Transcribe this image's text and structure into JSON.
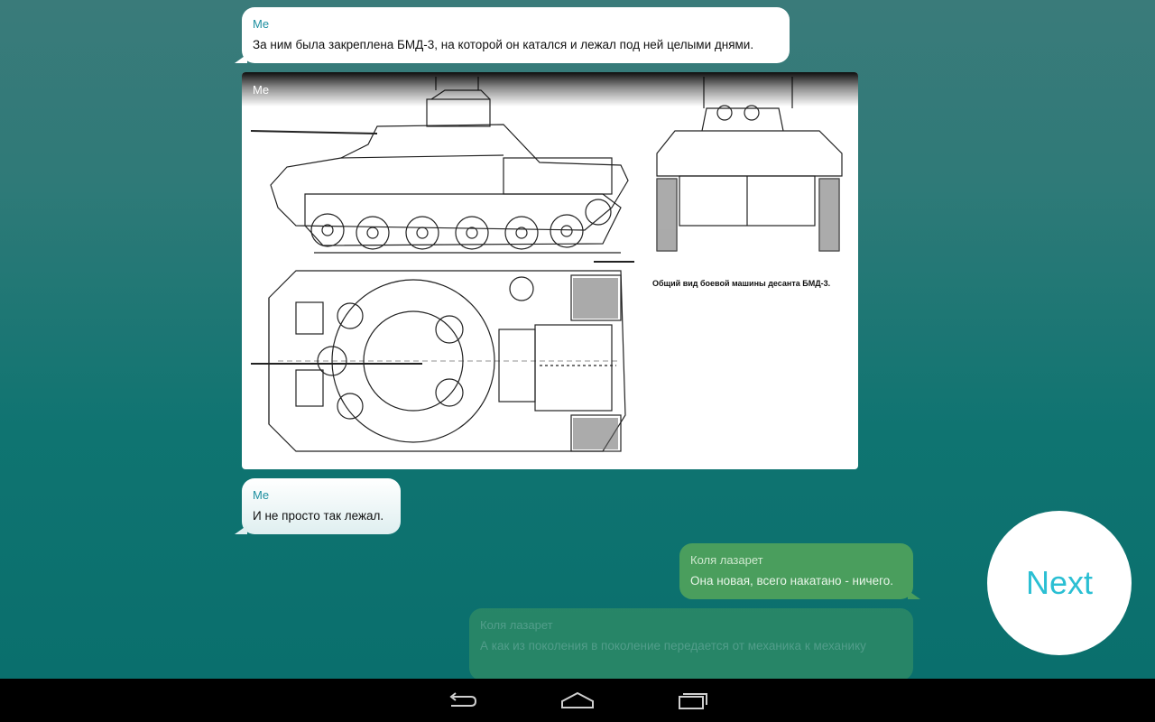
{
  "messages": [
    {
      "sender": "Me",
      "text": "За ним была закреплена БМД-3, на которой он катался и лежал под ней целыми днями."
    },
    {
      "sender": "Me",
      "image_caption": "Общий вид боевой машины десанта БМД-3."
    },
    {
      "sender": "Me",
      "text": "И не просто так лежал."
    },
    {
      "sender": "Коля лазарет",
      "text": "Она новая, всего накатано - ничего."
    },
    {
      "sender": "Коля лазарет",
      "text": "А как из поколения в поколение передается от механика к механику"
    }
  ],
  "next_button": {
    "label": "Next"
  },
  "nav": {
    "back_icon": "back-icon",
    "home_icon": "home-icon",
    "recents_icon": "recents-icon"
  },
  "colors": {
    "accent": "#2bbfd3",
    "bubble_other": "#4a9e5d",
    "bubble_me": "#ffffff"
  }
}
